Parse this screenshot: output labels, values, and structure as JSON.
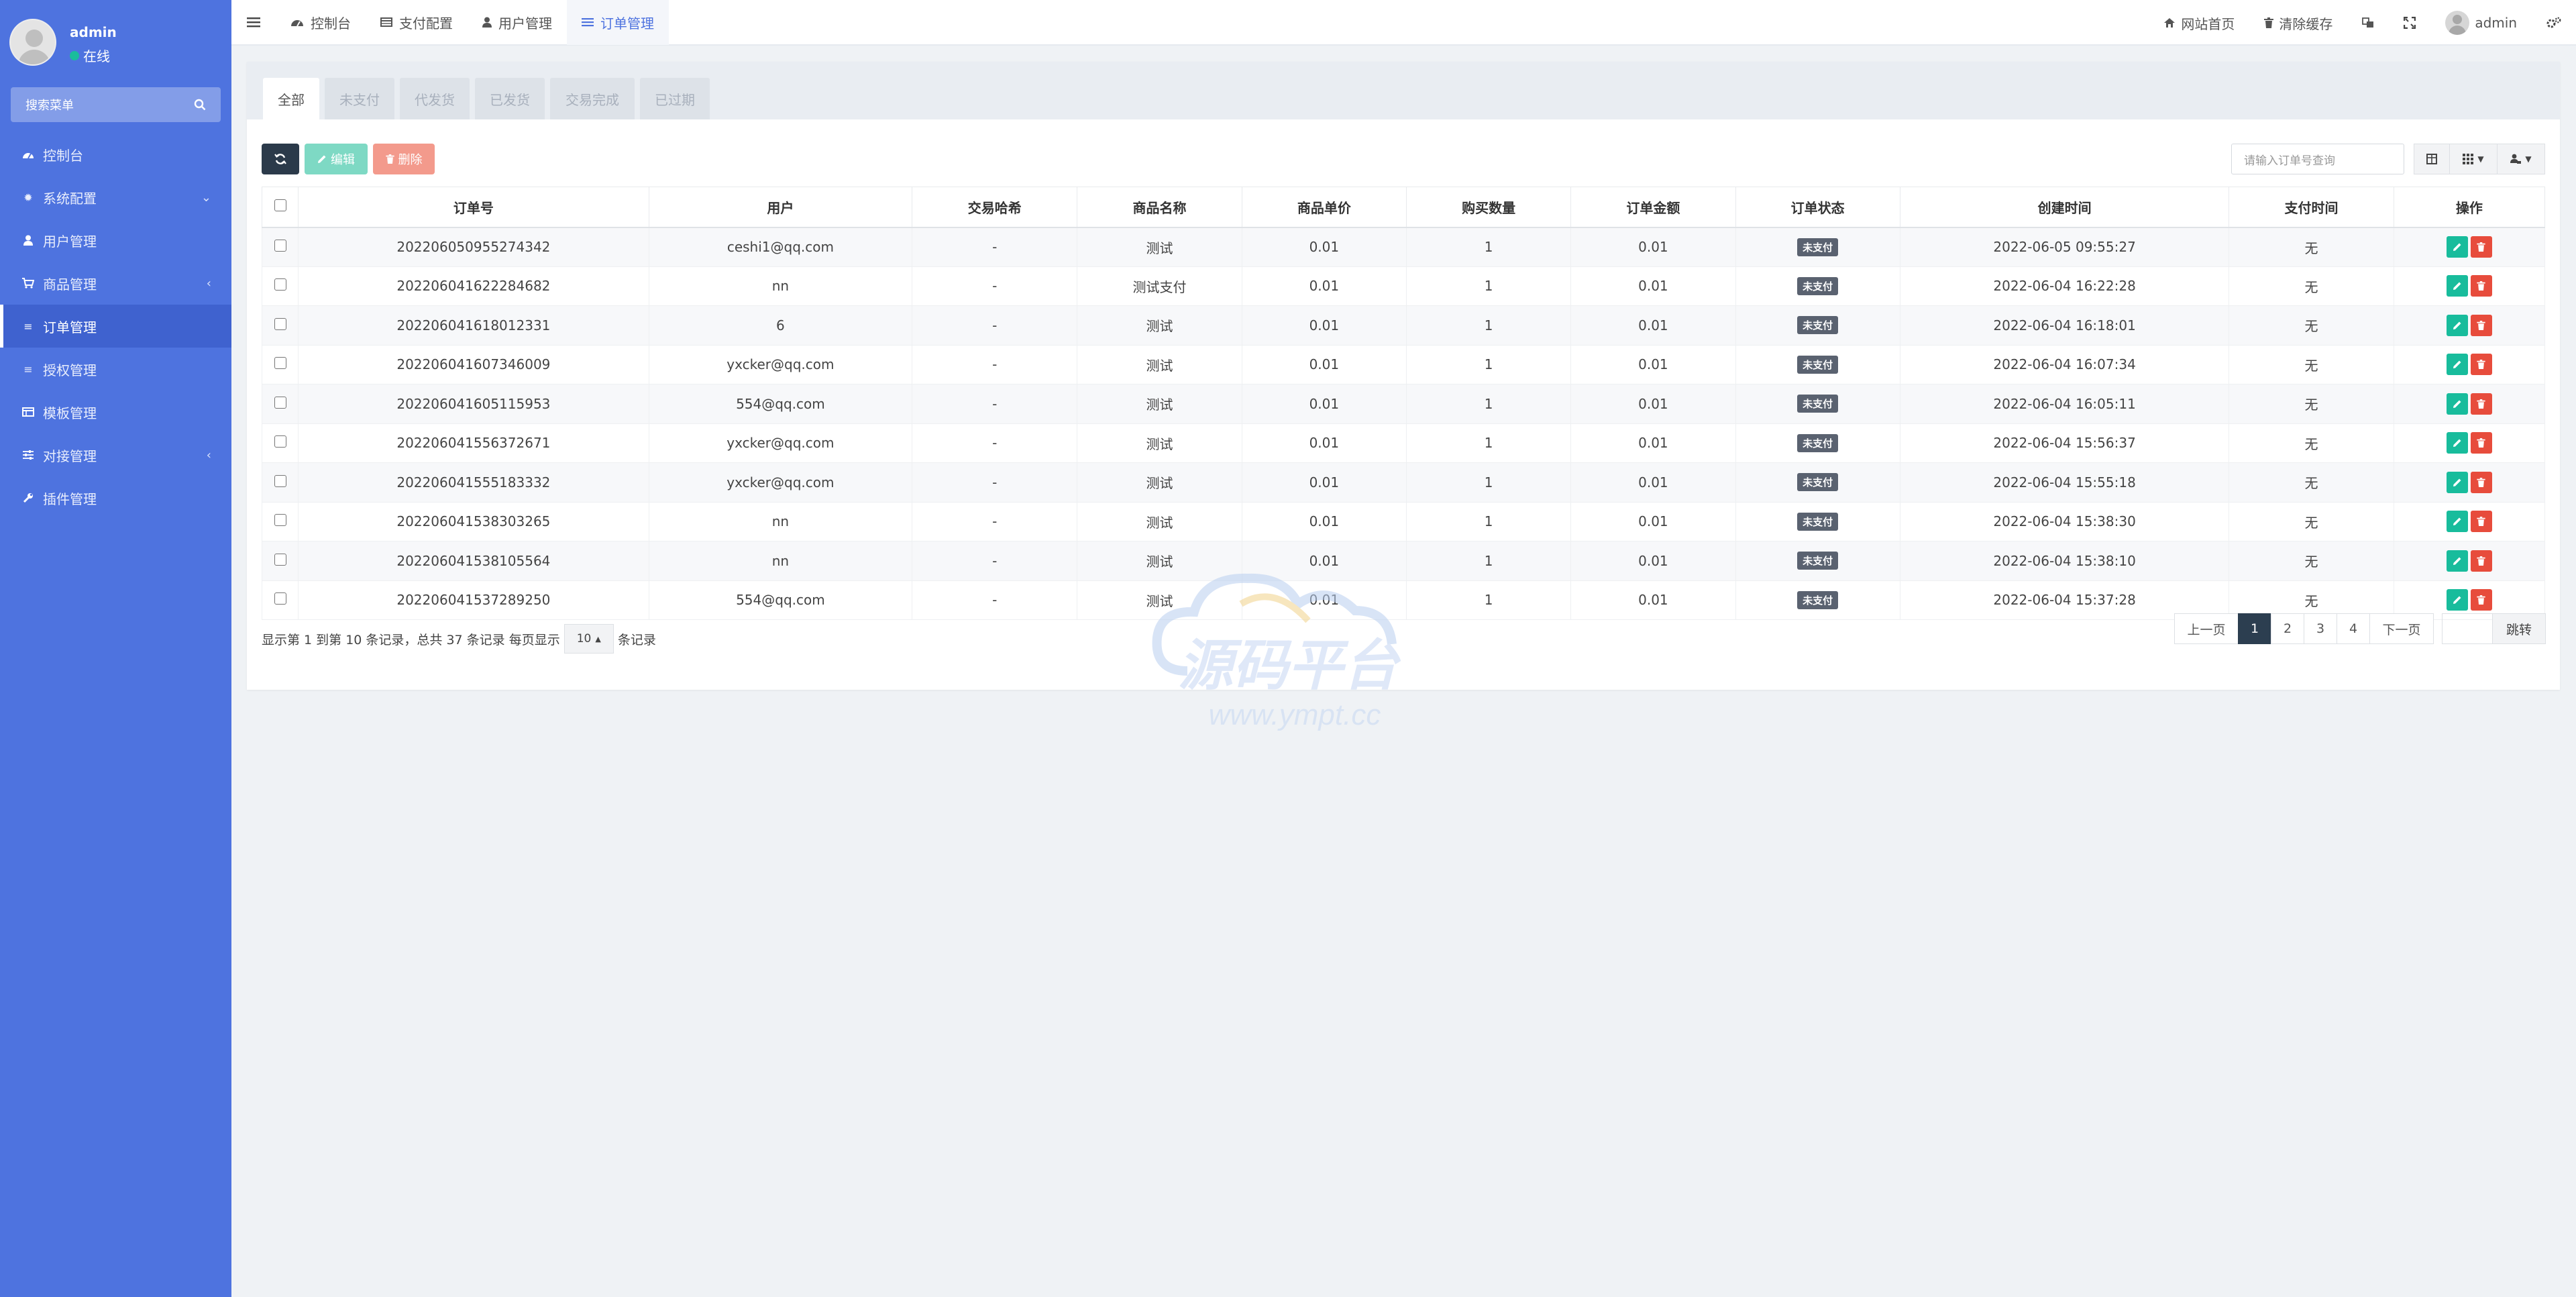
{
  "sidebar": {
    "user_name": "admin",
    "user_status": "在线",
    "search_placeholder": "搜索菜单",
    "items": [
      {
        "label": "控制台",
        "icon": "dashboard-icon"
      },
      {
        "label": "系统配置",
        "icon": "gear-icon"
      },
      {
        "label": "用户管理",
        "icon": "user-icon"
      },
      {
        "label": "商品管理",
        "icon": "cart-icon"
      },
      {
        "label": "订单管理",
        "icon": "list-icon"
      },
      {
        "label": "授权管理",
        "icon": "list-icon"
      },
      {
        "label": "模板管理",
        "icon": "table-icon"
      },
      {
        "label": "对接管理",
        "icon": "sliders-icon"
      },
      {
        "label": "插件管理",
        "icon": "wrench-icon"
      }
    ]
  },
  "topbar": {
    "tabs": [
      {
        "label": "控制台"
      },
      {
        "label": "支付配置"
      },
      {
        "label": "用户管理"
      },
      {
        "label": "订单管理"
      }
    ],
    "site_home": "网站首页",
    "clear_cache": "清除缓存",
    "user": "admin"
  },
  "filter_tabs": [
    "全部",
    "未支付",
    "代发货",
    "已发货",
    "交易完成",
    "已过期"
  ],
  "toolbar": {
    "edit_label": "编辑",
    "delete_label": "删除",
    "search_placeholder": "请输入订单号查询"
  },
  "table": {
    "headers": [
      "订单号",
      "用户",
      "交易哈希",
      "商品名称",
      "商品单价",
      "购买数量",
      "订单金额",
      "订单状态",
      "创建时间",
      "支付时间",
      "操作"
    ],
    "rows": [
      [
        "202206050955274342",
        "ceshi1@qq.com",
        "-",
        "测试",
        "0.01",
        "1",
        "0.01",
        "未支付",
        "2022-06-05 09:55:27",
        "无"
      ],
      [
        "202206041622284682",
        "nn",
        "-",
        "测试支付",
        "0.01",
        "1",
        "0.01",
        "未支付",
        "2022-06-04 16:22:28",
        "无"
      ],
      [
        "202206041618012331",
        "6",
        "-",
        "测试",
        "0.01",
        "1",
        "0.01",
        "未支付",
        "2022-06-04 16:18:01",
        "无"
      ],
      [
        "202206041607346009",
        "yxcker@qq.com",
        "-",
        "测试",
        "0.01",
        "1",
        "0.01",
        "未支付",
        "2022-06-04 16:07:34",
        "无"
      ],
      [
        "202206041605115953",
        "554@qq.com",
        "-",
        "测试",
        "0.01",
        "1",
        "0.01",
        "未支付",
        "2022-06-04 16:05:11",
        "无"
      ],
      [
        "202206041556372671",
        "yxcker@qq.com",
        "-",
        "测试",
        "0.01",
        "1",
        "0.01",
        "未支付",
        "2022-06-04 15:56:37",
        "无"
      ],
      [
        "202206041555183332",
        "yxcker@qq.com",
        "-",
        "测试",
        "0.01",
        "1",
        "0.01",
        "未支付",
        "2022-06-04 15:55:18",
        "无"
      ],
      [
        "202206041538303265",
        "nn",
        "-",
        "测试",
        "0.01",
        "1",
        "0.01",
        "未支付",
        "2022-06-04 15:38:30",
        "无"
      ],
      [
        "202206041538105564",
        "nn",
        "-",
        "测试",
        "0.01",
        "1",
        "0.01",
        "未支付",
        "2022-06-04 15:38:10",
        "无"
      ],
      [
        "202206041537289250",
        "554@qq.com",
        "-",
        "测试",
        "0.01",
        "1",
        "0.01",
        "未支付",
        "2022-06-04 15:37:28",
        "无"
      ]
    ]
  },
  "footer": {
    "info_text": "显示第 1 到第 10 条记录，总共 37 条记录 每页显示",
    "page_size": "10",
    "records_suffix": "条记录"
  },
  "pagination": {
    "prev": "上一页",
    "pages": [
      "1",
      "2",
      "3",
      "4"
    ],
    "next": "下一页",
    "jump": "跳转"
  },
  "watermark": {
    "title": "源码平台",
    "url": "www.ympt.cc"
  },
  "colors": {
    "sidebar": "#4e73df",
    "primary": "#4e73df",
    "success": "#18bc9c",
    "danger": "#e74c3c",
    "dark": "#2c3e50"
  }
}
